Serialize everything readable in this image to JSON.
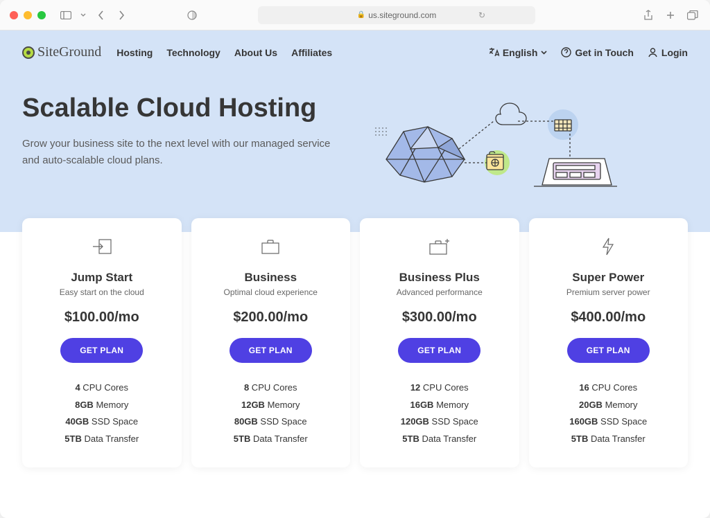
{
  "browser": {
    "url": "us.siteground.com"
  },
  "header": {
    "logo_text": "SiteGround",
    "nav": [
      "Hosting",
      "Technology",
      "About Us",
      "Affiliates"
    ],
    "language_label": "English",
    "contact_label": "Get in Touch",
    "login_label": "Login"
  },
  "hero": {
    "title": "Scalable Cloud Hosting",
    "subtitle": "Grow your business site to the next level with our managed service and auto-scalable cloud plans."
  },
  "plans": {
    "cta_label": "GET PLAN",
    "items": [
      {
        "name": "Jump Start",
        "tagline": "Easy start on the cloud",
        "price": "$100.00/mo",
        "cpu": "4",
        "cpu_label": " CPU Cores",
        "mem": "8GB",
        "mem_label": " Memory",
        "ssd": "40GB",
        "ssd_label": " SSD Space",
        "transfer": "5TB",
        "transfer_label": " Data Transfer"
      },
      {
        "name": "Business",
        "tagline": "Optimal cloud experience",
        "price": "$200.00/mo",
        "cpu": "8",
        "cpu_label": " CPU Cores",
        "mem": "12GB",
        "mem_label": " Memory",
        "ssd": "80GB",
        "ssd_label": " SSD Space",
        "transfer": "5TB",
        "transfer_label": " Data Transfer"
      },
      {
        "name": "Business Plus",
        "tagline": "Advanced performance",
        "price": "$300.00/mo",
        "cpu": "12",
        "cpu_label": " CPU Cores",
        "mem": "16GB",
        "mem_label": " Memory",
        "ssd": "120GB",
        "ssd_label": " SSD Space",
        "transfer": "5TB",
        "transfer_label": " Data Transfer"
      },
      {
        "name": "Super Power",
        "tagline": "Premium server power",
        "price": "$400.00/mo",
        "cpu": "16",
        "cpu_label": " CPU Cores",
        "mem": "20GB",
        "mem_label": " Memory",
        "ssd": "160GB",
        "ssd_label": " SSD Space",
        "transfer": "5TB",
        "transfer_label": " Data Transfer"
      }
    ]
  }
}
